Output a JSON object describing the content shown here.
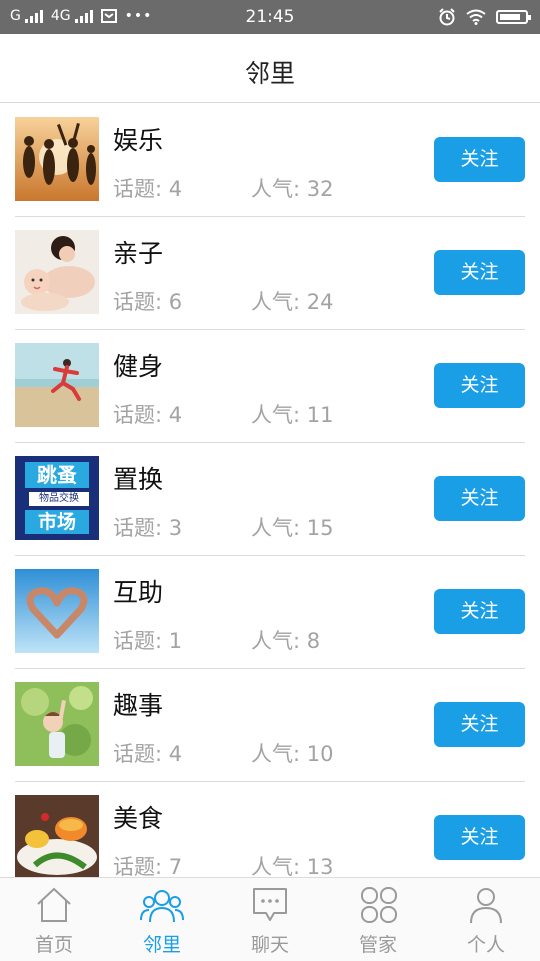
{
  "status_bar": {
    "carrier1": "G",
    "carrier2": "4G",
    "time": "21:45"
  },
  "header": {
    "title": "邻里"
  },
  "groups": [
    {
      "name": "娱乐",
      "topics": "话题: 4",
      "popularity": "人气: 32",
      "follow_label": "关注"
    },
    {
      "name": "亲子",
      "topics": "话题: 6",
      "popularity": "人气: 24",
      "follow_label": "关注"
    },
    {
      "name": "健身",
      "topics": "话题: 4",
      "popularity": "人气: 11",
      "follow_label": "关注"
    },
    {
      "name": "置换",
      "topics": "话题: 3",
      "popularity": "人气: 15",
      "follow_label": "关注",
      "thumb_text1": "跳蚤",
      "thumb_text2": "物品交换",
      "thumb_text3": "市场"
    },
    {
      "name": "互助",
      "topics": "话题: 1",
      "popularity": "人气: 8",
      "follow_label": "关注"
    },
    {
      "name": "趣事",
      "topics": "话题: 4",
      "popularity": "人气: 10",
      "follow_label": "关注"
    },
    {
      "name": "美食",
      "topics": "话题: 7",
      "popularity": "人气: 13",
      "follow_label": "关注"
    }
  ],
  "tabbar": {
    "tabs": [
      {
        "label": "首页",
        "icon": "home-icon"
      },
      {
        "label": "邻里",
        "icon": "neighbors-icon"
      },
      {
        "label": "聊天",
        "icon": "chat-icon"
      },
      {
        "label": "管家",
        "icon": "grid-icon"
      },
      {
        "label": "个人",
        "icon": "person-icon"
      }
    ],
    "active_index": 1
  },
  "colors": {
    "accent": "#1a9ee6",
    "status_bar": "#6b6b6b",
    "muted_text": "#a3a3a3"
  }
}
